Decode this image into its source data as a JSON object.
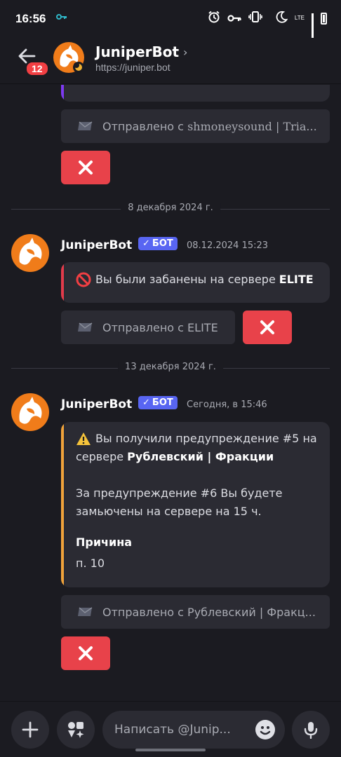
{
  "status_bar": {
    "time": "16:56",
    "network_label": "LTE"
  },
  "header": {
    "unread_count": "12",
    "bot_name": "JuniperBot",
    "url": "https://juniper.bot"
  },
  "messages": [
    {
      "id": "msg0",
      "sent_from": "Отправлено с ",
      "sent_from_server": "shmoneysound | Tria...",
      "accent_color": "#7e3af2"
    },
    {
      "id": "msg1",
      "date_divider": "8 декабря 2024 г.",
      "author": "JuniperBot",
      "bot_tag": "БОТ",
      "timestamp": "08.12.2024 15:23",
      "embed_text": "Вы были забанены на сервере ",
      "embed_server": "ELITE",
      "accent_color": "#e23b4b",
      "sent_from": "Отправлено с ELITE"
    },
    {
      "id": "msg2",
      "date_divider": "13 декабря 2024 г.",
      "author": "JuniperBot",
      "bot_tag": "БОТ",
      "timestamp": "Сегодня, в 15:46",
      "accent_color": "#f0a33b",
      "line1": "Вы получили предупреждение #5 на",
      "line2_prefix": "сервере ",
      "line2_server": "Рублевский | Фракции",
      "line3": "За предупреждение #6 Вы будете",
      "line4": "замьючены на сервере на 15 ч.",
      "reason_label": "Причина",
      "reason_value": "п. 10",
      "sent_from": "Отправлено с Рублевский | Фракц..."
    }
  ],
  "composer": {
    "placeholder": "Написать @Junip..."
  },
  "colors": {
    "danger": "#e8424a",
    "blurple": "#5865f2",
    "background": "#1b1b21",
    "surface": "#2b2b33"
  }
}
